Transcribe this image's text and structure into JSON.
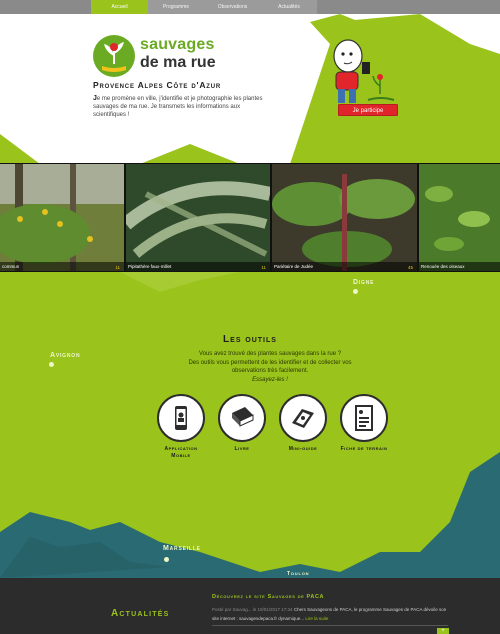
{
  "nav": {
    "items": [
      {
        "label": "Accueil",
        "active": true
      },
      {
        "label": "Programme",
        "active": false
      },
      {
        "label": "Observations",
        "active": false
      },
      {
        "label": "Actualités",
        "active": false
      }
    ]
  },
  "hero": {
    "brand_line1": "sauvages",
    "brand_line2": "de ma rue",
    "region": "Provence Alpes Côte d'Azur",
    "intro_cap": "J",
    "intro_text": "e me promène en ville, j'identifie et je photographie les plantes sauvages de ma rue. Je transmets les informations aux scientifiques !",
    "cta_label": "Je participe"
  },
  "carousel": {
    "photos": [
      {
        "caption": "commun",
        "count": "11",
        "icon": "photo-count-icon"
      },
      {
        "caption": "Pipitathère faux-millet",
        "count": "11",
        "icon": "photo-count-icon"
      },
      {
        "caption": "Pariétaire de Judée",
        "count": "45",
        "icon": "photo-count-icon"
      },
      {
        "caption": "Renouée des oiseaux",
        "count": "",
        "icon": "photo-count-icon"
      }
    ],
    "active_dot": 1
  },
  "map": {
    "cities": {
      "digne": "Digne",
      "avignon": "Avignon",
      "marseille": "Marseille",
      "toulon": "Toulon"
    },
    "colors": {
      "land": "#9ac31c",
      "sea": "#2a6a72"
    }
  },
  "outils": {
    "title": "Les outils",
    "line1": "Vous avez trouvé des plantes sauvages dans la rue ?",
    "line2": "Des outils vous permettent de les identifier et de collecter vos observations très facilement.",
    "line3": "Essayez-les !",
    "tools": [
      {
        "label_line1": "Application",
        "label_line2": "Mobile",
        "icon": "phone-icon"
      },
      {
        "label_line1": "Livre",
        "label_line2": "",
        "icon": "book-icon"
      },
      {
        "label_line1": "Mini-guide",
        "label_line2": "",
        "icon": "mini-guide-icon"
      },
      {
        "label_line1": "Fiche de terrain",
        "label_line2": "",
        "icon": "field-sheet-icon"
      }
    ]
  },
  "footer": {
    "title": "Actualités",
    "news_title": "Découvrez le site Sauvages de PACA",
    "news_meta": "Posté par Sauvag... le 10/01/2017 17:34",
    "news_text": "Chers Sauvageons de PACA, le programme Sauvages de PACA dévoile son site internet : sauvagesdepaca.fr dynamique...",
    "news_more": "Lire la suite",
    "plus_label": "+"
  }
}
